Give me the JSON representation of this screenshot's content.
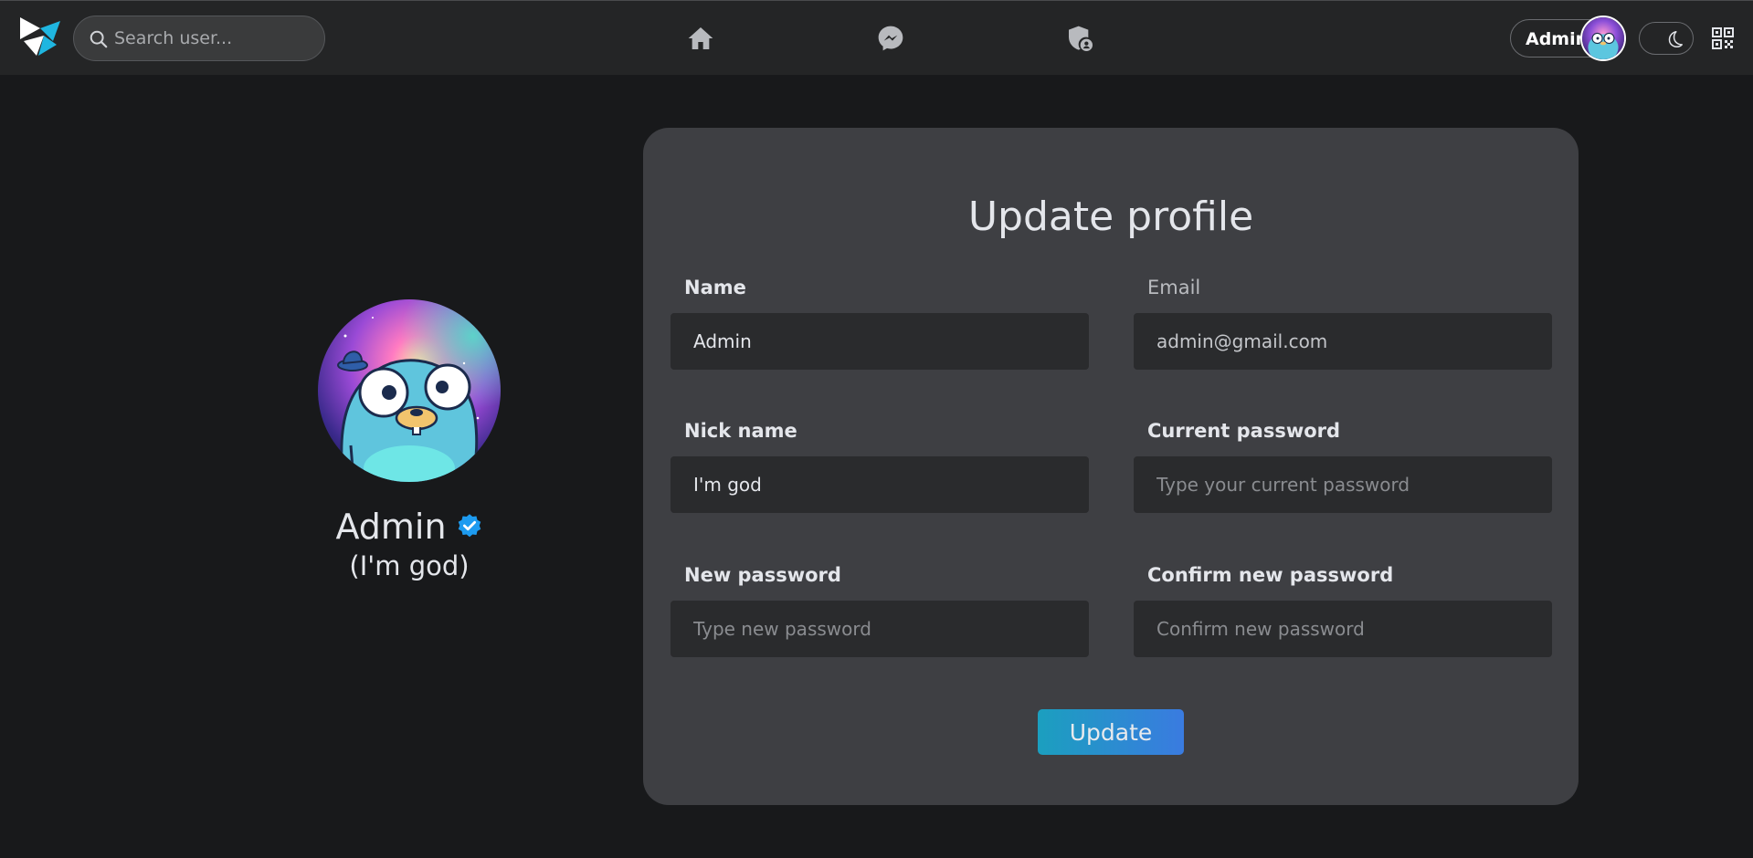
{
  "navbar": {
    "search_placeholder": "Search user...",
    "user_name": "Admin"
  },
  "profile": {
    "name": "Admin",
    "nickname": "(I'm god)"
  },
  "form": {
    "title": "Update profile",
    "name": {
      "label": "Name",
      "value": "Admin"
    },
    "email": {
      "label": "Email",
      "value": "admin@gmail.com"
    },
    "nickname": {
      "label": "Nick name",
      "value": "I'm god"
    },
    "current_password": {
      "label": "Current password",
      "placeholder": "Type your current password"
    },
    "new_password": {
      "label": "New password",
      "placeholder": "Type new password"
    },
    "confirm_password": {
      "label": "Confirm new password",
      "placeholder": "Confirm new password"
    },
    "submit_label": "Update"
  },
  "colors": {
    "background": "#18191b",
    "navbar": "#242526",
    "card": "#3e3f43",
    "input": "#2a2b2d",
    "accent_start": "#1b9fbf",
    "accent_end": "#3a7be0",
    "verified": "#1d9bf0"
  },
  "icons": [
    "logo-icon",
    "search-icon",
    "home-icon",
    "messenger-icon",
    "shield-user-icon",
    "moon-icon",
    "qr-code-icon",
    "verified-badge-icon"
  ]
}
